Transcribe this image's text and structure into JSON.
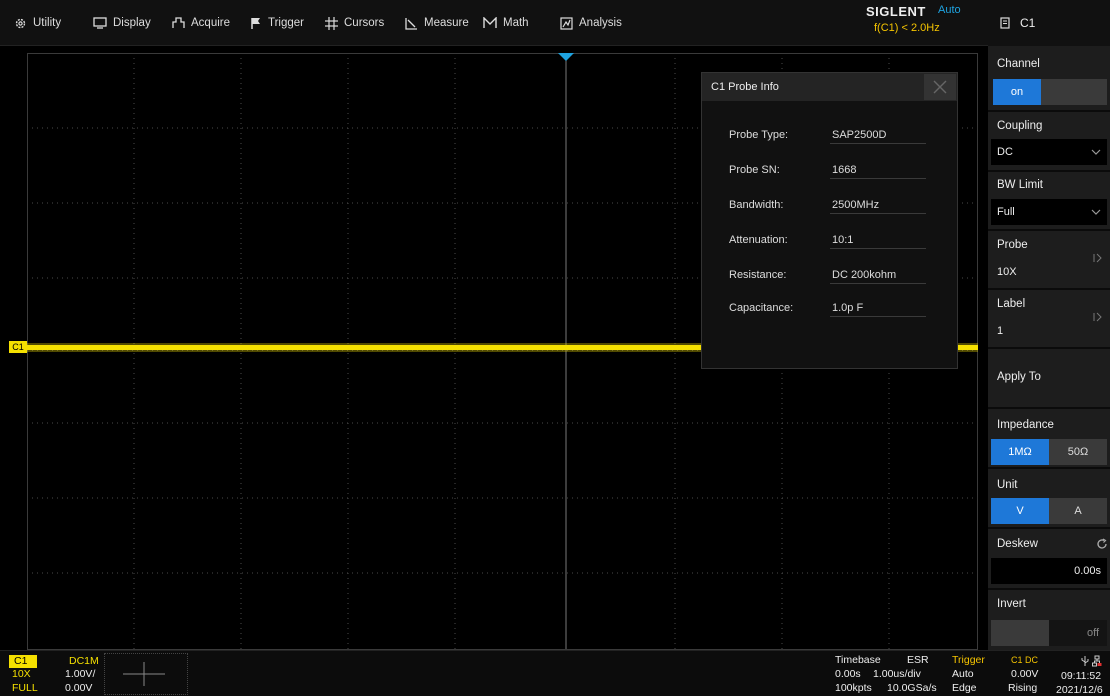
{
  "menu": [
    {
      "label": "Utility",
      "icon": "gear-icon"
    },
    {
      "label": "Display",
      "icon": "monitor-icon"
    },
    {
      "label": "Acquire",
      "icon": "acquire-icon"
    },
    {
      "label": "Trigger",
      "icon": "flag-icon"
    },
    {
      "label": "Cursors",
      "icon": "cursors-icon"
    },
    {
      "label": "Measure",
      "icon": "measure-icon"
    },
    {
      "label": "Math",
      "icon": "math-icon"
    },
    {
      "label": "Analysis",
      "icon": "analysis-icon"
    }
  ],
  "brand": {
    "name": "SIGLENT",
    "mode": "Auto",
    "trigger_info": "f(C1) < 2.0Hz"
  },
  "panel": {
    "title": "C1",
    "channel": {
      "label": "Channel",
      "value": "on"
    },
    "coupling": {
      "label": "Coupling",
      "value": "DC"
    },
    "bw_limit": {
      "label": "BW Limit",
      "value": "Full"
    },
    "probe": {
      "label": "Probe",
      "value": "10X"
    },
    "label": {
      "label": "Label",
      "value": "1"
    },
    "apply_to": {
      "label": "Apply To"
    },
    "impedance": {
      "label": "Impedance",
      "options": [
        "1MΩ",
        "50Ω"
      ],
      "selected": "1MΩ"
    },
    "unit": {
      "label": "Unit",
      "options": [
        "V",
        "A"
      ],
      "selected": "V"
    },
    "deskew": {
      "label": "Deskew",
      "value": "0.00s"
    },
    "invert": {
      "label": "Invert",
      "value": "off"
    }
  },
  "probe_info": {
    "title": "C1 Probe Info",
    "rows": [
      {
        "key": "Probe Type:",
        "value": "SAP2500D"
      },
      {
        "key": "Probe SN:",
        "value": "1668"
      },
      {
        "key": "Bandwidth:",
        "value": "2500MHz"
      },
      {
        "key": "Attenuation:",
        "value": "10:1"
      },
      {
        "key": "Resistance:",
        "value": "DC 200kohm"
      },
      {
        "key": "Capacitance:",
        "value": "1.0p F"
      }
    ]
  },
  "channel_marker": "C1",
  "channel_box": {
    "name": "C1",
    "coupling": "DC1M",
    "probe": "10X",
    "scale": "1.00V/",
    "bw": "FULL",
    "offset": "0.00V"
  },
  "timebase": {
    "label": "Timebase",
    "mode": "ESR",
    "delay": "0.00s",
    "scale": "1.00us/div",
    "points": "100kpts",
    "rate": "10.0GSa/s"
  },
  "trigger": {
    "label": "Trigger",
    "mode": "Auto",
    "type": "Edge",
    "source": "C1 DC",
    "level": "0.00V",
    "slope": "Rising"
  },
  "clock": {
    "time": "09:11:52",
    "date": "2021/12/6"
  },
  "colors": {
    "ch1": "#f5e000",
    "accent": "#1e78d8",
    "trigger": "#f5c400"
  }
}
